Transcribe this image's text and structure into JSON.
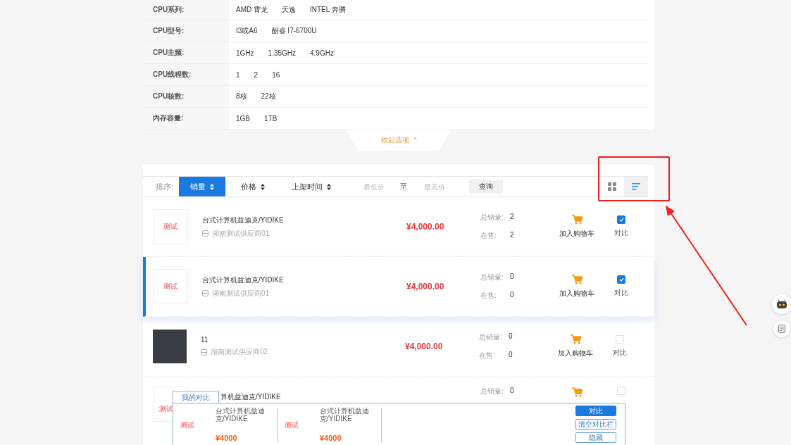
{
  "filters": [
    {
      "label": "CPU系列:",
      "options": [
        "AMD 霄龙",
        "天逸",
        "INTEL 奔腾"
      ]
    },
    {
      "label": "CPU型号:",
      "options": [
        "I3或A6",
        "酷睿 I7-6700U"
      ]
    },
    {
      "label": "CPU主频:",
      "options": [
        "1GHz",
        "1.35GHz",
        "4.9GHz"
      ]
    },
    {
      "label": "CPU线程数:",
      "options": [
        "1",
        "2",
        "16"
      ]
    },
    {
      "label": "CPU核数:",
      "options": [
        "8核",
        "22核"
      ]
    },
    {
      "label": "内存容量:",
      "options": [
        "1GB",
        "1TB"
      ]
    }
  ],
  "collapse": {
    "label": "收起选项",
    "icon": "^"
  },
  "sort": {
    "label": "排序:",
    "options": [
      {
        "label": "销量",
        "selected": true
      },
      {
        "label": "价格",
        "selected": false
      },
      {
        "label": "上架时间",
        "selected": false
      }
    ],
    "min_price": {
      "placeholder": "最低价"
    },
    "separator": "至",
    "max_price": {
      "placeholder": "最高价"
    },
    "query_button": "查询",
    "views": [
      {
        "kind": "grid",
        "selected": false
      },
      {
        "kind": "list",
        "selected": true
      }
    ]
  },
  "products": [
    {
      "thumb": {
        "kind": "text",
        "text": "测试"
      },
      "name": "台式计算机益迪克/YIDIKE",
      "supplier": "湖南测试供应商01",
      "price": "¥4,000.00",
      "total_sales_label": "总销量:",
      "total_sales": "2",
      "on_sale_label": "在售:",
      "on_sale": "2",
      "cart_label": "加入购物车",
      "compare_label": "对比",
      "compared": true,
      "highlighted": false
    },
    {
      "thumb": {
        "kind": "text",
        "text": "测试"
      },
      "name": "台式计算机益迪克/YIDIKE",
      "supplier": "湖南测试供应商01",
      "price": "¥4,000.00",
      "total_sales_label": "总销量:",
      "total_sales": "0",
      "on_sale_label": "在售:",
      "on_sale": "0",
      "cart_label": "加入购物车",
      "compare_label": "对比",
      "compared": true,
      "highlighted": true
    },
    {
      "thumb": {
        "kind": "photo"
      },
      "name": "11",
      "supplier": "湖南测试供应商02",
      "price": "¥4,000.00",
      "total_sales_label": "总销量:",
      "total_sales": "0",
      "on_sale_label": "在售:",
      "on_sale": "0",
      "cart_label": "加入购物车",
      "compare_label": "对比",
      "compared": false,
      "highlighted": false
    },
    {
      "thumb": {
        "kind": "text",
        "text": "测试"
      },
      "name": "算机益迪克/YIDIKE",
      "total_sales_label": "总销量:",
      "total_sales": "0",
      "compared": false,
      "highlighted": false
    }
  ],
  "compare_bar": {
    "tab": "我的对比",
    "items": [
      {
        "thumb_text": "测试",
        "name": "台式计算机益迪克/YIDIKE",
        "price": "¥4000"
      },
      {
        "thumb_text": "测试",
        "name": "台式计算机益迪克/YIDIKE",
        "price": "¥4000"
      }
    ],
    "buttons": [
      {
        "label": "对比",
        "kind": "primary"
      },
      {
        "label": "清空对比栏",
        "kind": "outline"
      },
      {
        "label": "隐藏",
        "kind": "outline"
      }
    ]
  }
}
